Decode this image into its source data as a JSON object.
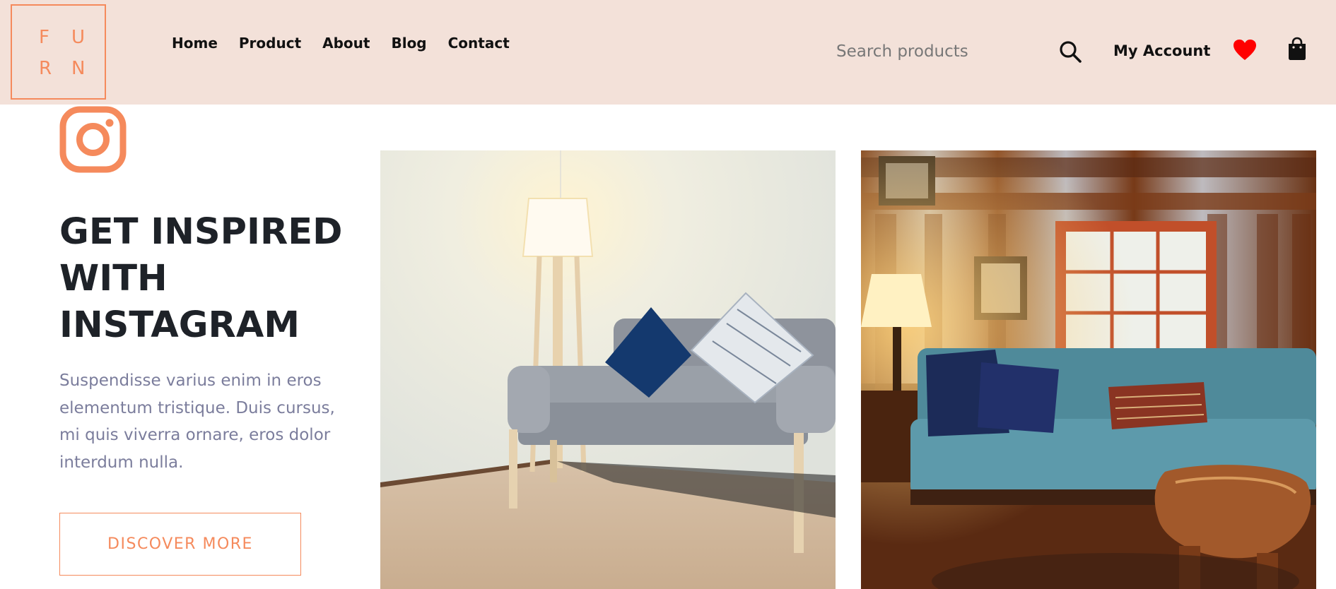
{
  "brand": {
    "logo_letters": [
      "F",
      "U",
      "R",
      "N"
    ],
    "accent": "#f58a5c",
    "header_bg": "#f3e1d9"
  },
  "nav": {
    "items": [
      "Home",
      "Product",
      "About",
      "Blog",
      "Contact"
    ]
  },
  "search": {
    "placeholder": "Search products",
    "icon": "search-icon"
  },
  "header_actions": {
    "account_label": "My Account",
    "wishlist_icon": "heart-icon",
    "cart_icon": "shopping-bag-icon",
    "heart_color": "#ff0000"
  },
  "hero": {
    "icon": "instagram-icon",
    "heading": "GET INSPIRED WITH INSTAGRAM",
    "description": "Suspendisse varius enim in eros elementum tristique. Duis cursus, mi quis viverra ornare, eros dolor interdum nulla.",
    "button_label": "DISCOVER MORE"
  },
  "gallery": [
    {
      "name": "living-room-gray-sofa-photo"
    },
    {
      "name": "log-cabin-blue-sofa-photo"
    }
  ]
}
